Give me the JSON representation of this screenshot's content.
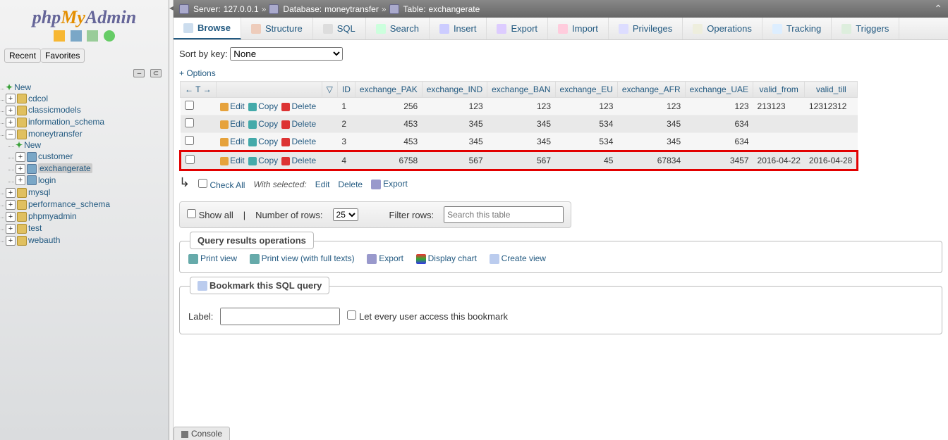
{
  "logo": {
    "php": "php",
    "my": "My",
    "admin": "Admin"
  },
  "recent": "Recent",
  "favorites": "Favorites",
  "tree": {
    "new": "New",
    "dbs": [
      {
        "name": "cdcol"
      },
      {
        "name": "classicmodels"
      },
      {
        "name": "information_schema"
      },
      {
        "name": "moneytransfer",
        "expanded": true,
        "children": [
          {
            "name": "New",
            "isNew": true
          },
          {
            "name": "customer"
          },
          {
            "name": "exchangerate",
            "selected": true
          },
          {
            "name": "login"
          }
        ]
      },
      {
        "name": "mysql"
      },
      {
        "name": "performance_schema"
      },
      {
        "name": "phpmyadmin"
      },
      {
        "name": "test"
      },
      {
        "name": "webauth"
      }
    ]
  },
  "breadcrumb": {
    "server_lbl": "Server:",
    "server_val": "127.0.0.1",
    "db_lbl": "Database:",
    "db_val": "moneytransfer",
    "tbl_lbl": "Table:",
    "tbl_val": "exchangerate"
  },
  "tabs": [
    {
      "key": "browse",
      "label": "Browse",
      "icon": "i-browse",
      "active": true
    },
    {
      "key": "structure",
      "label": "Structure",
      "icon": "i-struct"
    },
    {
      "key": "sql",
      "label": "SQL",
      "icon": "i-sql"
    },
    {
      "key": "search",
      "label": "Search",
      "icon": "i-search"
    },
    {
      "key": "insert",
      "label": "Insert",
      "icon": "i-insert"
    },
    {
      "key": "export",
      "label": "Export",
      "icon": "i-export"
    },
    {
      "key": "import",
      "label": "Import",
      "icon": "i-import"
    },
    {
      "key": "privileges",
      "label": "Privileges",
      "icon": "i-priv"
    },
    {
      "key": "operations",
      "label": "Operations",
      "icon": "i-ops"
    },
    {
      "key": "tracking",
      "label": "Tracking",
      "icon": "i-track"
    },
    {
      "key": "triggers",
      "label": "Triggers",
      "icon": "i-trig"
    }
  ],
  "sort_key_label": "Sort by key:",
  "sort_key_value": "None",
  "options_link": "+ Options",
  "columns": [
    "ID",
    "exchange_PAK",
    "exchange_IND",
    "exchange_BAN",
    "exchange_EU",
    "exchange_AFR",
    "exchange_UAE",
    "valid_from",
    "valid_till"
  ],
  "row_actions": {
    "edit": "Edit",
    "copy": "Copy",
    "delete": "Delete"
  },
  "rows": [
    {
      "id": "1",
      "pak": "256",
      "ind": "123",
      "ban": "123",
      "eu": "123",
      "afr": "123",
      "uae": "123",
      "from": "213123",
      "till": "12312312"
    },
    {
      "id": "2",
      "pak": "453",
      "ind": "345",
      "ban": "345",
      "eu": "534",
      "afr": "345",
      "uae": "634",
      "from": "",
      "till": ""
    },
    {
      "id": "3",
      "pak": "453",
      "ind": "345",
      "ban": "345",
      "eu": "534",
      "afr": "345",
      "uae": "634",
      "from": "",
      "till": ""
    },
    {
      "id": "4",
      "pak": "6758",
      "ind": "567",
      "ban": "567",
      "eu": "45",
      "afr": "67834",
      "uae": "3457",
      "from": "2016-04-22",
      "till": "2016-04-28",
      "highlight": true
    }
  ],
  "check_all": "Check All",
  "with_selected": "With selected:",
  "ws_edit": "Edit",
  "ws_delete": "Delete",
  "ws_export": "Export",
  "toolbar": {
    "show_all": "Show all",
    "num_rows": "Number of rows:",
    "rows_value": "25",
    "filter": "Filter rows:",
    "filter_ph": "Search this table"
  },
  "qro": {
    "legend": "Query results operations",
    "print": "Print view",
    "printfull": "Print view (with full texts)",
    "export": "Export",
    "chart": "Display chart",
    "view": "Create view"
  },
  "bookmark": {
    "legend": "Bookmark this SQL query",
    "label": "Label:",
    "share": "Let every user access this bookmark"
  },
  "console": "Console"
}
